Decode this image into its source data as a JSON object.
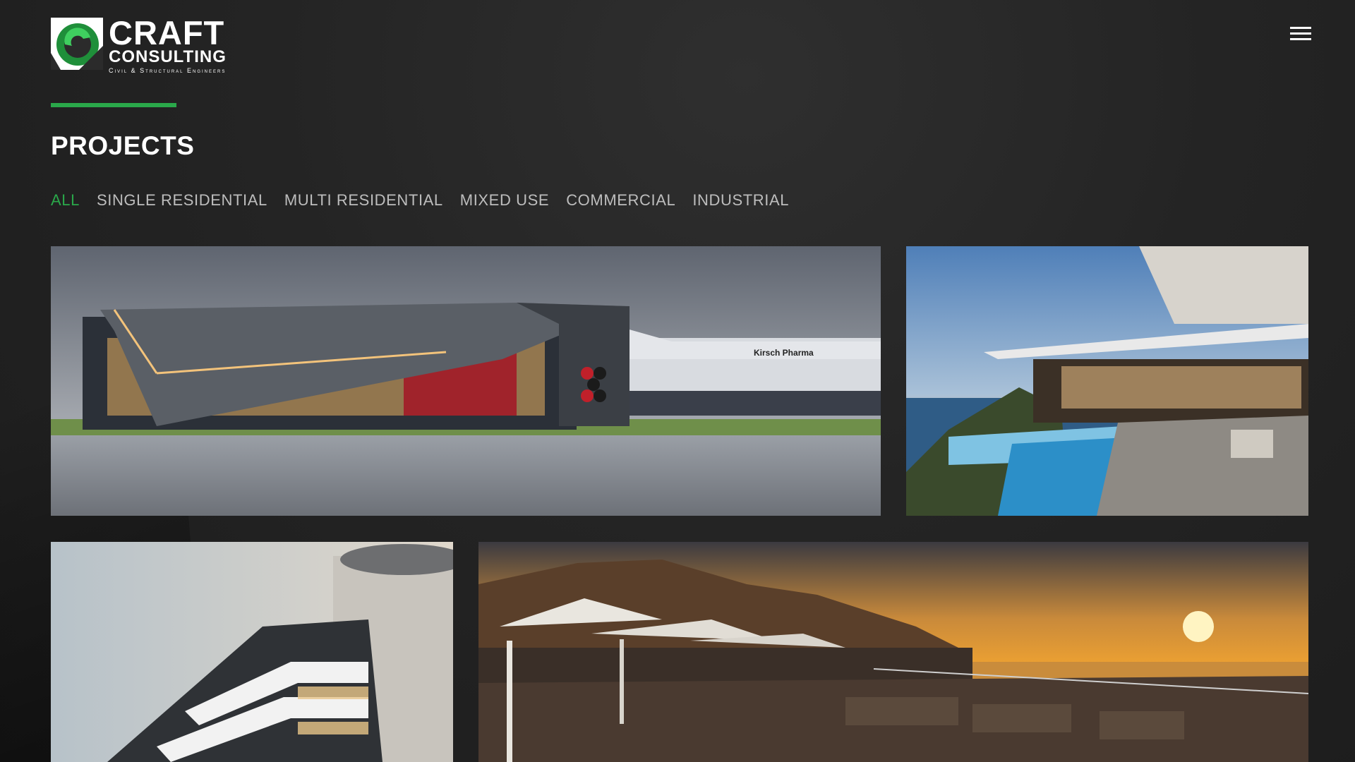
{
  "brand": {
    "name": "CRAFT",
    "subname": "CONSULTING",
    "tagline": "Civil & Structural Engineers",
    "accent": "#2aa84a"
  },
  "header": {
    "menu_icon": "hamburger-menu-icon"
  },
  "page": {
    "title": "PROJECTS"
  },
  "filters": [
    {
      "label": "ALL",
      "active": true
    },
    {
      "label": "SINGLE RESIDENTIAL",
      "active": false
    },
    {
      "label": "MULTI RESIDENTIAL",
      "active": false
    },
    {
      "label": "MIXED USE",
      "active": false
    },
    {
      "label": "COMMERCIAL",
      "active": false
    },
    {
      "label": "INDUSTRIAL",
      "active": false
    }
  ],
  "projects": [
    {
      "image": "modern-industrial-pharma-building-photo",
      "sign": "Kirsch Pharma"
    },
    {
      "image": "cliffside-villa-infinity-pool-photo"
    },
    {
      "image": "curved-white-apartment-tower-photo"
    },
    {
      "image": "rooftop-terrace-sunset-ocean-photo"
    }
  ]
}
